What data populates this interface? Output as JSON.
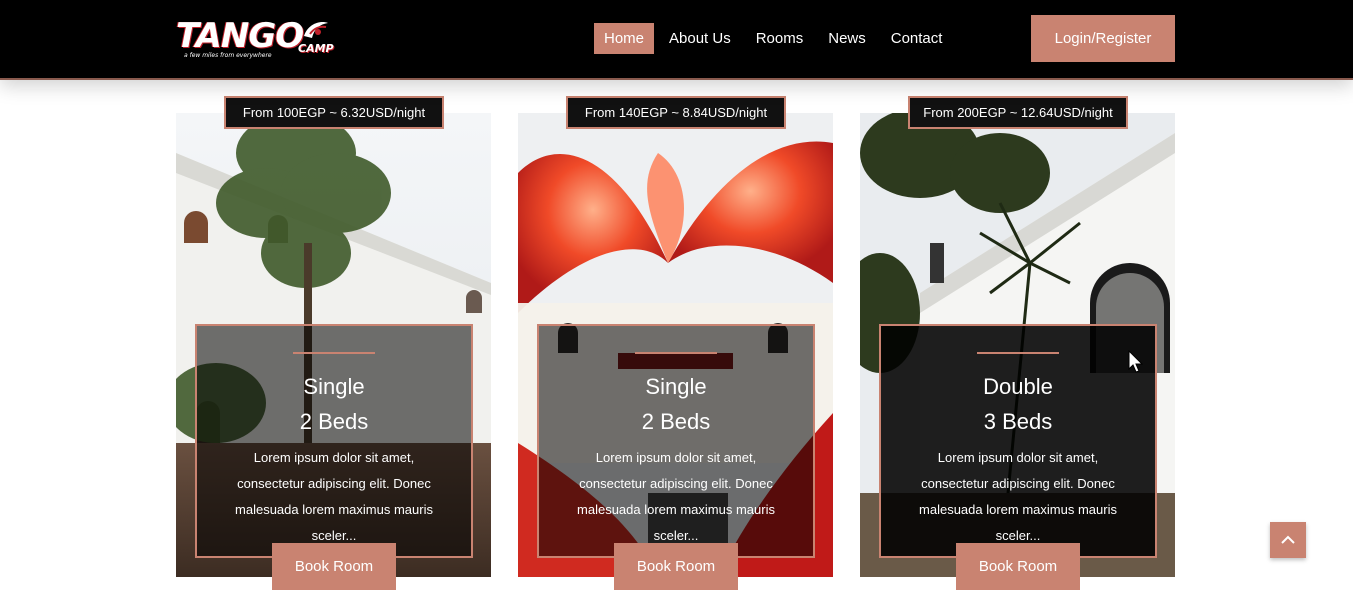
{
  "header": {
    "logo_text": "TANGO",
    "logo_camp": "CAMP",
    "logo_tagline": "a few miles from everywhere",
    "nav": [
      {
        "label": "Home",
        "active": true
      },
      {
        "label": "About Us",
        "active": false
      },
      {
        "label": "Rooms",
        "active": false
      },
      {
        "label": "News",
        "active": false
      },
      {
        "label": "Contact",
        "active": false
      }
    ],
    "login_label": "Login/Register"
  },
  "rooms": [
    {
      "price": "From 100EGP ~ 6.32USD/night",
      "type": "Single",
      "beds": "2 Beds",
      "description": "Lorem ipsum dolor sit amet, consectetur adipiscing elit. Donec malesuada lorem maximus mauris sceler...",
      "book_label": "Book Room"
    },
    {
      "price": "From 140EGP ~ 8.84USD/night",
      "type": "Single",
      "beds": "2 Beds",
      "description": "Lorem ipsum dolor sit amet, consectetur adipiscing elit. Donec malesuada lorem maximus mauris sceler...",
      "book_label": "Book Room"
    },
    {
      "price": "From 200EGP ~ 12.64USD/night",
      "type": "Double",
      "beds": "3 Beds",
      "description": "Lorem ipsum dolor sit amet, consectetur adipiscing elit. Donec malesuada lorem maximus mauris sceler...",
      "book_label": "Book Room"
    }
  ],
  "scroll_top_icon": "chevron-up-icon",
  "colors": {
    "accent": "#c98371",
    "header_bg": "#000000",
    "badge_bg": "#111111"
  }
}
